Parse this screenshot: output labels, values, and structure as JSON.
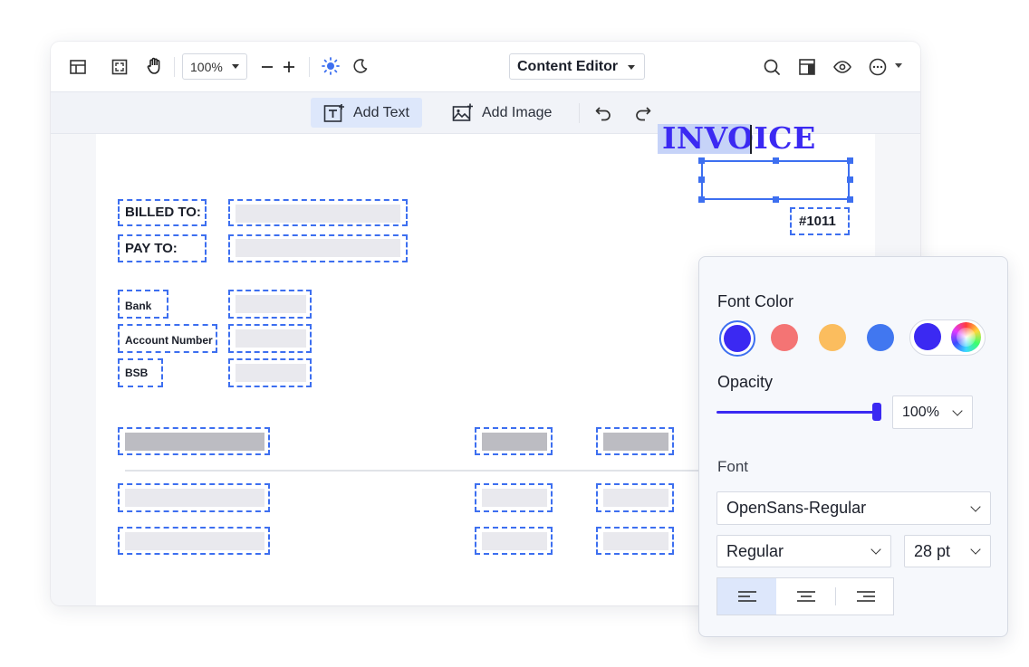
{
  "toolbar": {
    "zoom_value": "100%",
    "mode_label": "Content Editor",
    "icons": [
      "layout-icon",
      "fullscreen-icon",
      "hand-icon",
      "zoom-out-icon",
      "zoom-in-icon",
      "sun-icon",
      "moon-icon",
      "search-icon",
      "panel-layout-icon",
      "eye-icon",
      "more-icon"
    ]
  },
  "subtoolbar": {
    "add_text_label": "Add Text",
    "add_image_label": "Add Image"
  },
  "document": {
    "invoice_title": "INVOICE",
    "invoice_number": "#1011",
    "billed_to_label": "BILLED TO:",
    "pay_to_label": "PAY TO:",
    "bank_label": "Bank",
    "account_number_label": "Account Number",
    "bsb_label": "BSB"
  },
  "panel": {
    "font_color_title": "Font Color",
    "colors": {
      "selected": "#3b29f2",
      "red": "#f47474",
      "yellow": "#fbbd5e",
      "blue": "#4177f0",
      "custom": "#3b29f2"
    },
    "opacity_title": "Opacity",
    "opacity_value": "100%",
    "opacity_level": 1.0,
    "font_title": "Font",
    "font_family": "OpenSans-Regular",
    "font_style": "Regular",
    "font_size": "28 pt",
    "alignment": "left"
  }
}
